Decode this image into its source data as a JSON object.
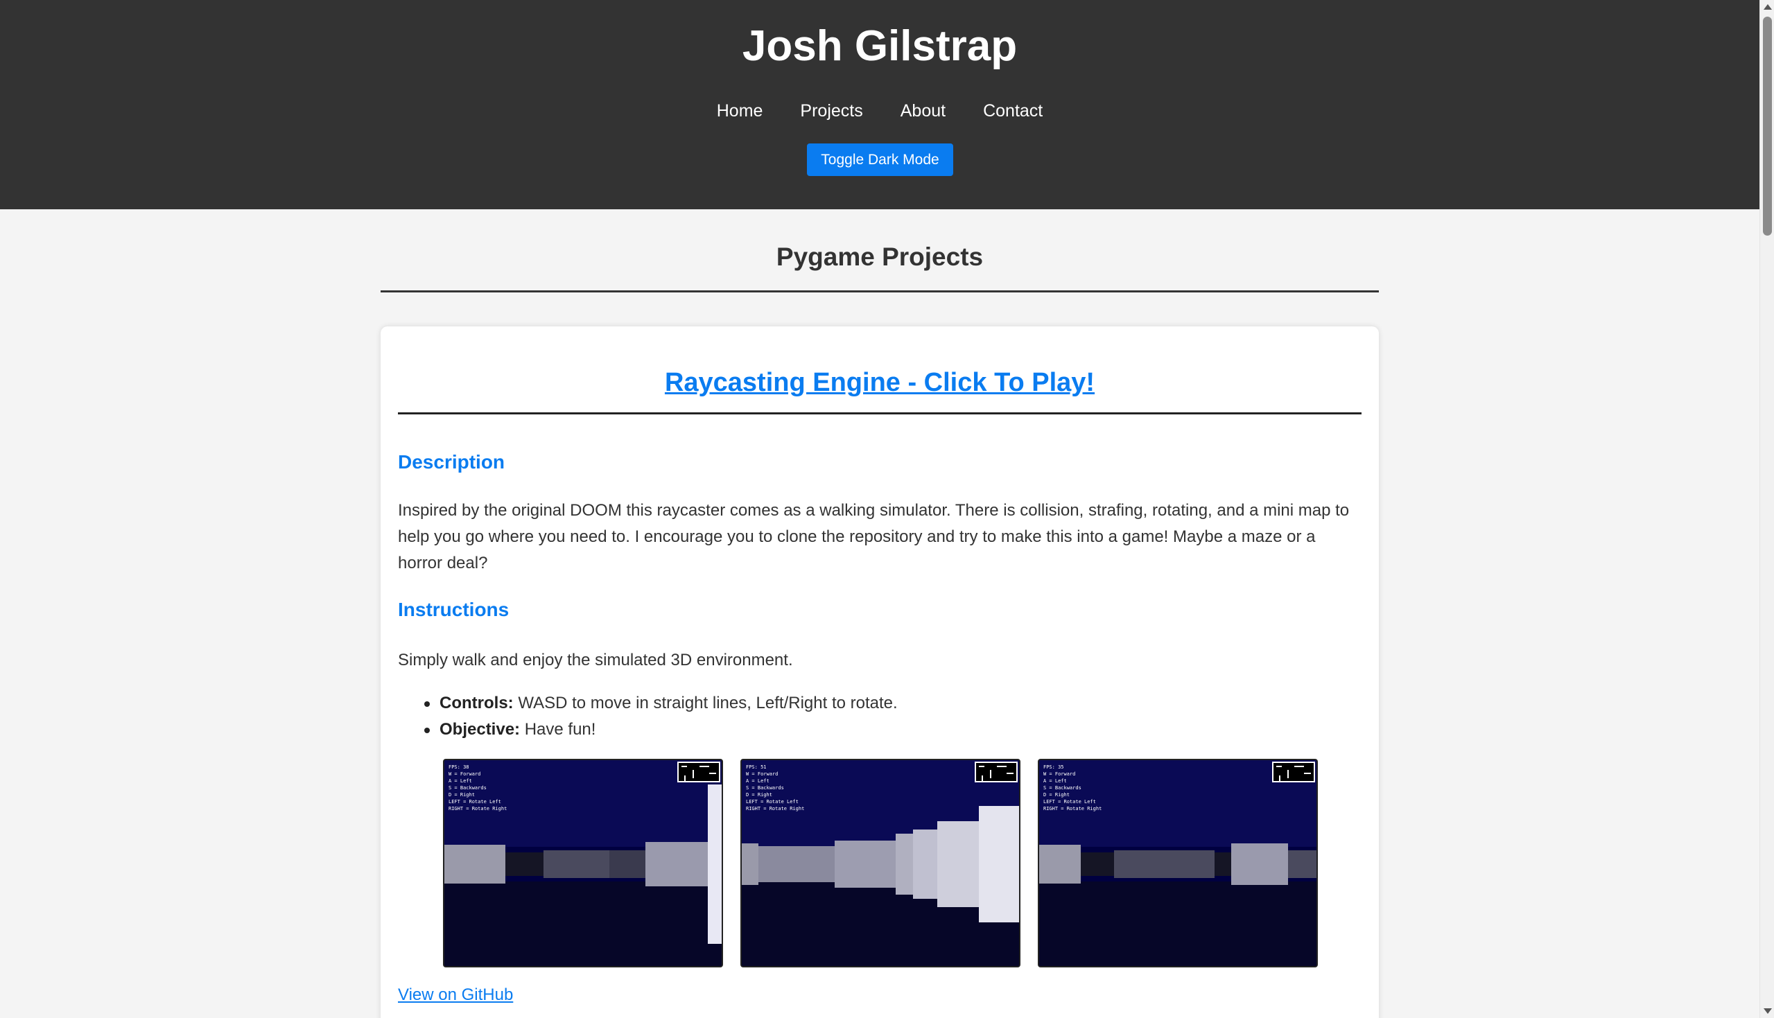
{
  "header": {
    "title": "Josh Gilstrap",
    "nav": [
      "Home",
      "Projects",
      "About",
      "Contact"
    ],
    "toggle_label": "Toggle Dark Mode"
  },
  "main": {
    "section_title": "Pygame Projects",
    "project": {
      "title": "Raycasting Engine - Click To Play!",
      "description_heading": "Description",
      "description": "Inspired by the original DOOM this raycaster comes as a walking simulator. There is collision, strafing, rotating, and a mini map to help you go where you need to. I encourage you to clone the repository and try to make this into a game! Maybe a maze or a horror deal?",
      "instructions_heading": "Instructions",
      "instructions": "Simply walk and enjoy the simulated 3D environment.",
      "bullets": [
        {
          "label": "Controls:",
          "text": " WASD to move in straight lines, Left/Right to rotate."
        },
        {
          "label": "Objective:",
          "text": " Have fun!"
        }
      ],
      "screenshots": [
        {
          "hud": "FPS: 38\nW = Forward\nA = Left\nS = Backwards\nD = Right\nLEFT = Rotate Left\nRIGHT = Rotate Right"
        },
        {
          "hud": "FPS: 51\nW = Forward\nA = Left\nS = Backwards\nD = Right\nLEFT = Rotate Left\nRIGHT = Rotate Right"
        },
        {
          "hud": "FPS: 35\nW = Forward\nA = Left\nS = Backwards\nD = Right\nLEFT = Rotate Left\nRIGHT = Rotate Right"
        }
      ],
      "github_label": "View on GitHub"
    }
  },
  "colors": {
    "header_bg": "#333333",
    "accent": "#0a7cf0",
    "page_bg": "#f4f4f4"
  }
}
